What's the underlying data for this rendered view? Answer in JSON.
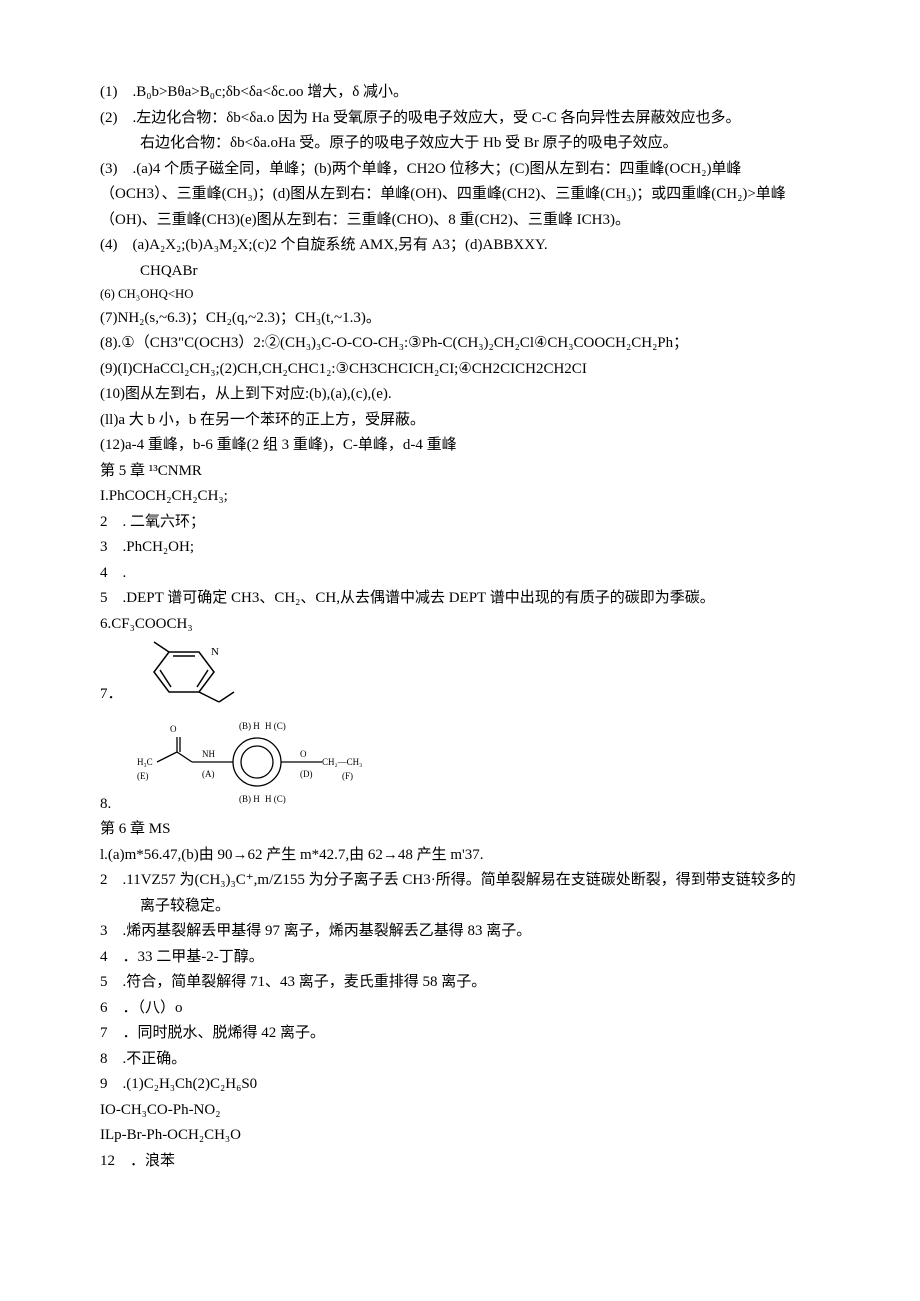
{
  "l1": "(1) .B₀b>Bθa>B₀c;δb<δa<δc.oo 增大，δ 减小。",
  "l2": "(2) .左边化合物：δb<δa.o 因为 Ha 受氧原子的吸电子效应大，受 C-C 各向异性去屏蔽效应也多。",
  "l2b": "右边化合物：δb<δa.oHa 受。原子的吸电子效应大于 Hb 受 Br 原子的吸电子效应。",
  "l3": "(3) .(a)4 个质子磁全同，单峰；(b)两个单峰，CH2O 位移大；(C)图从左到右：四重峰(OCH₂)单峰",
  "l3b": "（OCH3）、三重峰(CH₃)；(d)图从左到右：单峰(OH)、四重峰(CH2)、三重峰(CH₃)；或四重峰(CH₂)>单峰",
  "l3c": "（OH)、三重峰(CH3)(e)图从左到右：三重峰(CHO)、8 重(CH2)、三重峰 ICH3)。",
  "l4": "(4) (a)A₂X₂;(b)A₃M₂X;(c)2 个自旋系统 AMX,另有 A3；(d)ABBXXY.",
  "l4b": "CHQABr",
  "l6": "(6) CH₃OHQ<HO",
  "l7": "(7)NH₂(s,~6.3)；CH₂(q,~2.3)；CH₃(t,~1.3)。",
  "l8": "(8).①（CH3\"C(OCH3）2:②(CH₃)₃C-O-CO-CH₃:③Ph-C(CH₃)₂CH₂Cl④CH₃COOCH₂CH₂Ph；",
  "l9": "(9)(I)CHaCCl₂CH₃;(2)CH,CH₂CHC1₂:③CH3CHCICH₂CI;④CH2CICH2CH2CI",
  "l10": "(10)图从左到右，从上到下对应:(b),(a),(c),(e).",
  "l11": "(ll)a 大 b 小，b 在另一个苯环的正上方，受屏蔽。",
  "l12": "(12)a-4 重峰，b-6 重峰(2 组 3 重峰)，C-单峰，d-4 重峰",
  "ch5": "第 5 章 ¹³CNMR",
  "c5_1": "I.PhCOCH₂CH₂CH₃;",
  "c5_2": "2 . 二氧六环；",
  "c5_3": "3 .PhCH₂OH;",
  "c5_4": "4 .",
  "c5_5": "5 .DEPT 谱可确定 CH3、CH₂、CH,从去偶谱中减去 DEPT 谱中出现的有质子的碳即为季碳。",
  "c5_6": "6.CF₃COOCH₃",
  "c5_7": "7．",
  "c5_8": "8.",
  "ch6": "第 6 章 MS",
  "m1": "l.(a)m*56.47,(b)由 90→62 产生 m*42.7,由 62→48 产生 m'37.",
  "m2": "2 .11VZ57 为(CH₃)₃C⁺,m/Z155 为分子离子丢 CH3·所得。简单裂解易在支链碳处断裂，得到带支链较多的",
  "m2b": "离子较稳定。",
  "m3": "3 .烯丙基裂解丢甲基得 97 离子，烯丙基裂解丢乙基得 83 离子。",
  "m4": "4 ．33 二甲基-2-丁醇。",
  "m5": "5 .符合，简单裂解得 71、43 离子，麦氏重排得 58 离子。",
  "m6": "6 ．（八）o",
  "m7": "7 ．同时脱水、脱烯得 42 离子。",
  "m8": "8 .不正确。",
  "m9": "9 .(1)C₂H₃Ch(2)C₂H₆S0",
  "m10": "IO-CH₃CO-Ph-NO₂",
  "m11": "ILp-Br-Ph-OCH₂CH₃O",
  "m12": "12 ．浪苯"
}
